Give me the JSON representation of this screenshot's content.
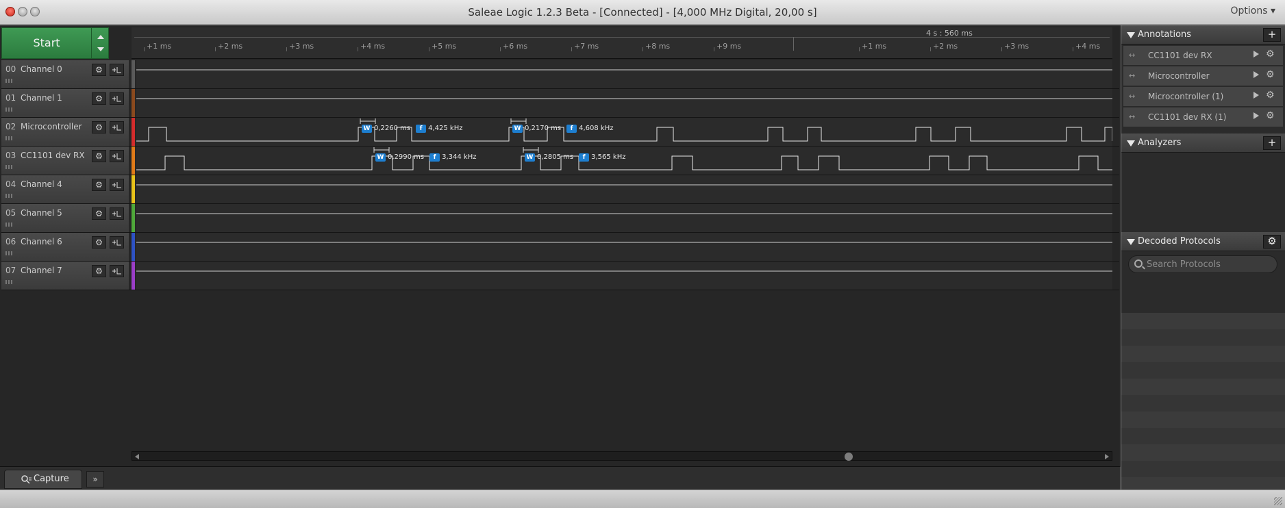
{
  "window": {
    "title": "Saleae Logic 1.2.3 Beta - [Connected] - [4,000 MHz Digital, 20,00 s]",
    "options_label": "Options ▾"
  },
  "toolbar": {
    "start_label": "Start",
    "center_time": "4 s : 560 ms",
    "ticks_left": [
      "+1 ms",
      "+2 ms",
      "+3 ms",
      "+4 ms",
      "+5 ms",
      "+6 ms",
      "+7 ms",
      "+8 ms",
      "+9 ms"
    ],
    "ticks_right": [
      "+1 ms",
      "+2 ms",
      "+3 ms",
      "+4 ms"
    ]
  },
  "channels": [
    {
      "num": "00",
      "name": "Channel 0",
      "color": "#5a5a5a"
    },
    {
      "num": "01",
      "name": "Channel 1",
      "color": "#8b4a1e"
    },
    {
      "num": "02",
      "name": "Microcontroller",
      "color": "#d42c2c"
    },
    {
      "num": "03",
      "name": "CC1101 dev RX",
      "color": "#e07b19"
    },
    {
      "num": "04",
      "name": "Channel 4",
      "color": "#e8c21a"
    },
    {
      "num": "05",
      "name": "Channel 5",
      "color": "#4fa83a"
    },
    {
      "num": "06",
      "name": "Channel 6",
      "color": "#2e52c4"
    },
    {
      "num": "07",
      "name": "Channel 7",
      "color": "#9b3ec8"
    }
  ],
  "measurements": {
    "micro": [
      {
        "width": "0,2260 ms",
        "freq": "4,425 kHz"
      },
      {
        "width": "0,2170 ms",
        "freq": "4,608 kHz"
      }
    ],
    "cc1101": [
      {
        "width": "0,2990 ms",
        "freq": "3,344 kHz"
      },
      {
        "width": "0,2805 ms",
        "freq": "3,565 kHz"
      }
    ],
    "badge_w": "W",
    "badge_f": "f"
  },
  "tabs": {
    "capture": "Capture",
    "more": "»"
  },
  "annotations": {
    "title": "Annotations",
    "items": [
      "CC1101 dev RX",
      "Microcontroller",
      "Microcontroller  (1)",
      "CC1101 dev RX (1)"
    ]
  },
  "analyzers": {
    "title": "Analyzers"
  },
  "decoded": {
    "title": "Decoded Protocols",
    "search_placeholder": "Search Protocols"
  },
  "icons": {
    "add": "+",
    "gear": "⚙",
    "play": "play-icon",
    "search": "search-icon"
  }
}
